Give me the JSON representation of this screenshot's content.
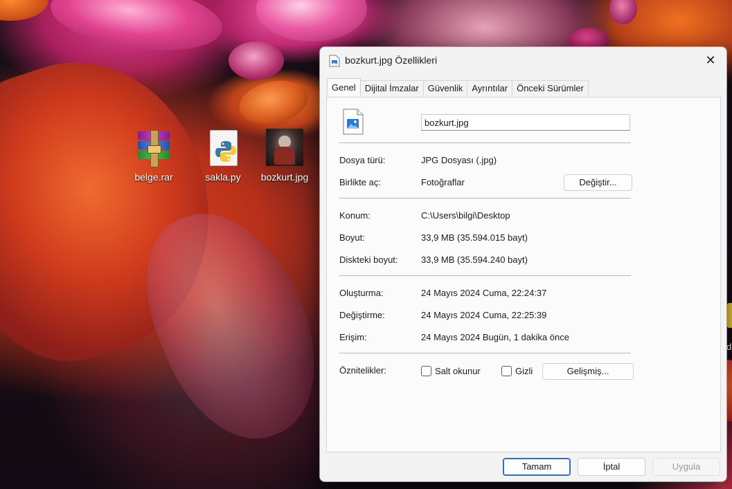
{
  "desktop": {
    "icons": [
      {
        "label": "belge.rar",
        "icon": "winrar-archive-icon"
      },
      {
        "label": "sakla.py",
        "icon": "python-file-icon"
      },
      {
        "label": "bozkurt.jpg",
        "icon": "image-thumbnail-icon"
      }
    ],
    "edge_letter": "d"
  },
  "dialog": {
    "title": "bozkurt.jpg Özellikleri",
    "close_glyph": "✕",
    "tabs": [
      {
        "label": "Genel",
        "active": true
      },
      {
        "label": "Dijital İmzalar",
        "active": false
      },
      {
        "label": "Güvenlik",
        "active": false
      },
      {
        "label": "Ayrıntılar",
        "active": false
      },
      {
        "label": "Önceki Sürümler",
        "active": false
      }
    ],
    "general": {
      "filename": "bozkurt.jpg",
      "file_type_label": "Dosya türü:",
      "file_type_value": "JPG Dosyası (.jpg)",
      "open_with_label": "Birlikte aç:",
      "open_with_value": "Fotoğraflar",
      "change_button": "Değiştir...",
      "location_label": "Konum:",
      "location_value": "C:\\Users\\bilgi\\Desktop",
      "size_label": "Boyut:",
      "size_value": "33,9 MB (35.594.015 bayt)",
      "disk_size_label": "Diskteki boyut:",
      "disk_size_value": "33,9 MB (35.594.240 bayt)",
      "created_label": "Oluşturma:",
      "created_value": "24 Mayıs 2024 Cuma, 22:24:37",
      "modified_label": "Değiştirme:",
      "modified_value": "24 Mayıs 2024 Cuma, 22:25:39",
      "accessed_label": "Erişim:",
      "accessed_value": "24 Mayıs 2024 Bugün, 1 dakika önce",
      "attributes_label": "Öznitelikler:",
      "readonly_label": "Salt okunur",
      "readonly_checked": false,
      "hidden_label": "Gizli",
      "hidden_checked": false,
      "advanced_button": "Gelişmiş..."
    },
    "footer": {
      "ok": "Tamam",
      "cancel": "İptal",
      "apply": "Uygula",
      "apply_enabled": false
    },
    "colors": {
      "accent": "#2f6fbe",
      "panel_bg": "#fbfbfb",
      "dialog_bg": "#f3f3f3"
    }
  }
}
